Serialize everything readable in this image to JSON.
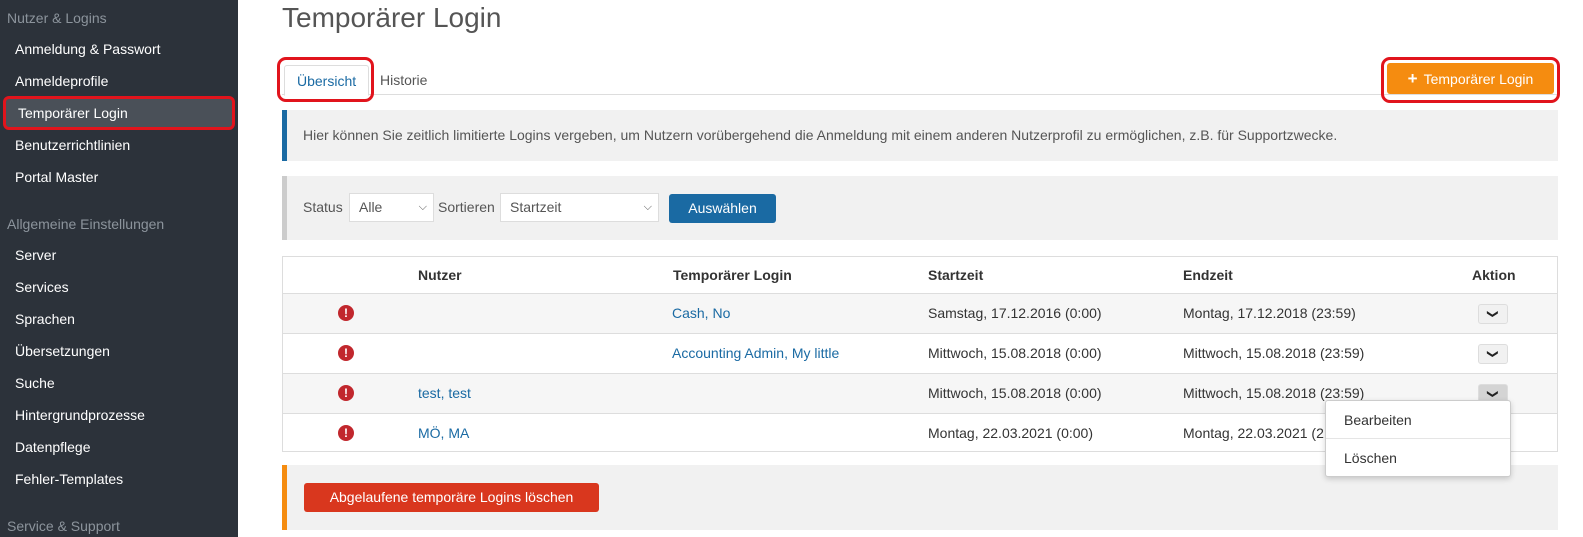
{
  "sidebar": {
    "group1": "Nutzer & Logins",
    "items1": [
      "Anmeldung & Passwort",
      "Anmeldeprofile",
      "Temporärer Login",
      "Benutzerrichtlinien",
      "Portal Master"
    ],
    "group2": "Allgemeine Einstellungen",
    "items2": [
      "Server",
      "Services",
      "Sprachen",
      "Übersetzungen",
      "Suche",
      "Hintergrundprozesse",
      "Datenpflege",
      "Fehler-Templates"
    ],
    "group3": "Service & Support"
  },
  "page": {
    "title": "Temporärer Login"
  },
  "tabs": [
    "Übersicht",
    "Historie"
  ],
  "add_button": {
    "icon": "plus-icon",
    "label": "Temporärer Login"
  },
  "info_text": "Hier können Sie zeitlich limitierte Logins vergeben, um Nutzern vorübergehend die Anmeldung mit einem anderen Nutzerprofil zu ermöglichen, z.B. für Supportzwecke.",
  "filter": {
    "status_label": "Status",
    "status_value": "Alle",
    "sort_label": "Sortieren",
    "sort_value": "Startzeit",
    "apply_label": "Auswählen"
  },
  "table": {
    "headers": [
      "Nutzer",
      "Temporärer Login",
      "Startzeit",
      "Endzeit",
      "Aktion"
    ],
    "rows": [
      {
        "user": "",
        "temp_login": "Cash, No",
        "start": "Samstag, 17.12.2016 (0:00)",
        "end": "Montag, 17.12.2018 (23:59)"
      },
      {
        "user": "",
        "temp_login": "Accounting Admin, My little",
        "start": "Mittwoch, 15.08.2018 (0:00)",
        "end": "Mittwoch, 15.08.2018 (23:59)"
      },
      {
        "user": "test, test",
        "temp_login": "",
        "start": "Mittwoch, 15.08.2018 (0:00)",
        "end": "Mittwoch, 15.08.2018 (23:59)"
      },
      {
        "user": "MÖ, MA",
        "temp_login": "",
        "start": "Montag, 22.03.2021 (0:00)",
        "end": "Montag, 22.03.2021 (2"
      }
    ]
  },
  "action_menu": [
    "Bearbeiten",
    "Löschen"
  ],
  "delete_expired_label": "Abgelaufene temporäre Logins löschen",
  "colors": {
    "sidebar_bg": "#2c323a",
    "accent_blue": "#1a6aa3",
    "orange": "#f58c10",
    "danger_red": "#d9371e",
    "highlight": "#e1141c"
  }
}
